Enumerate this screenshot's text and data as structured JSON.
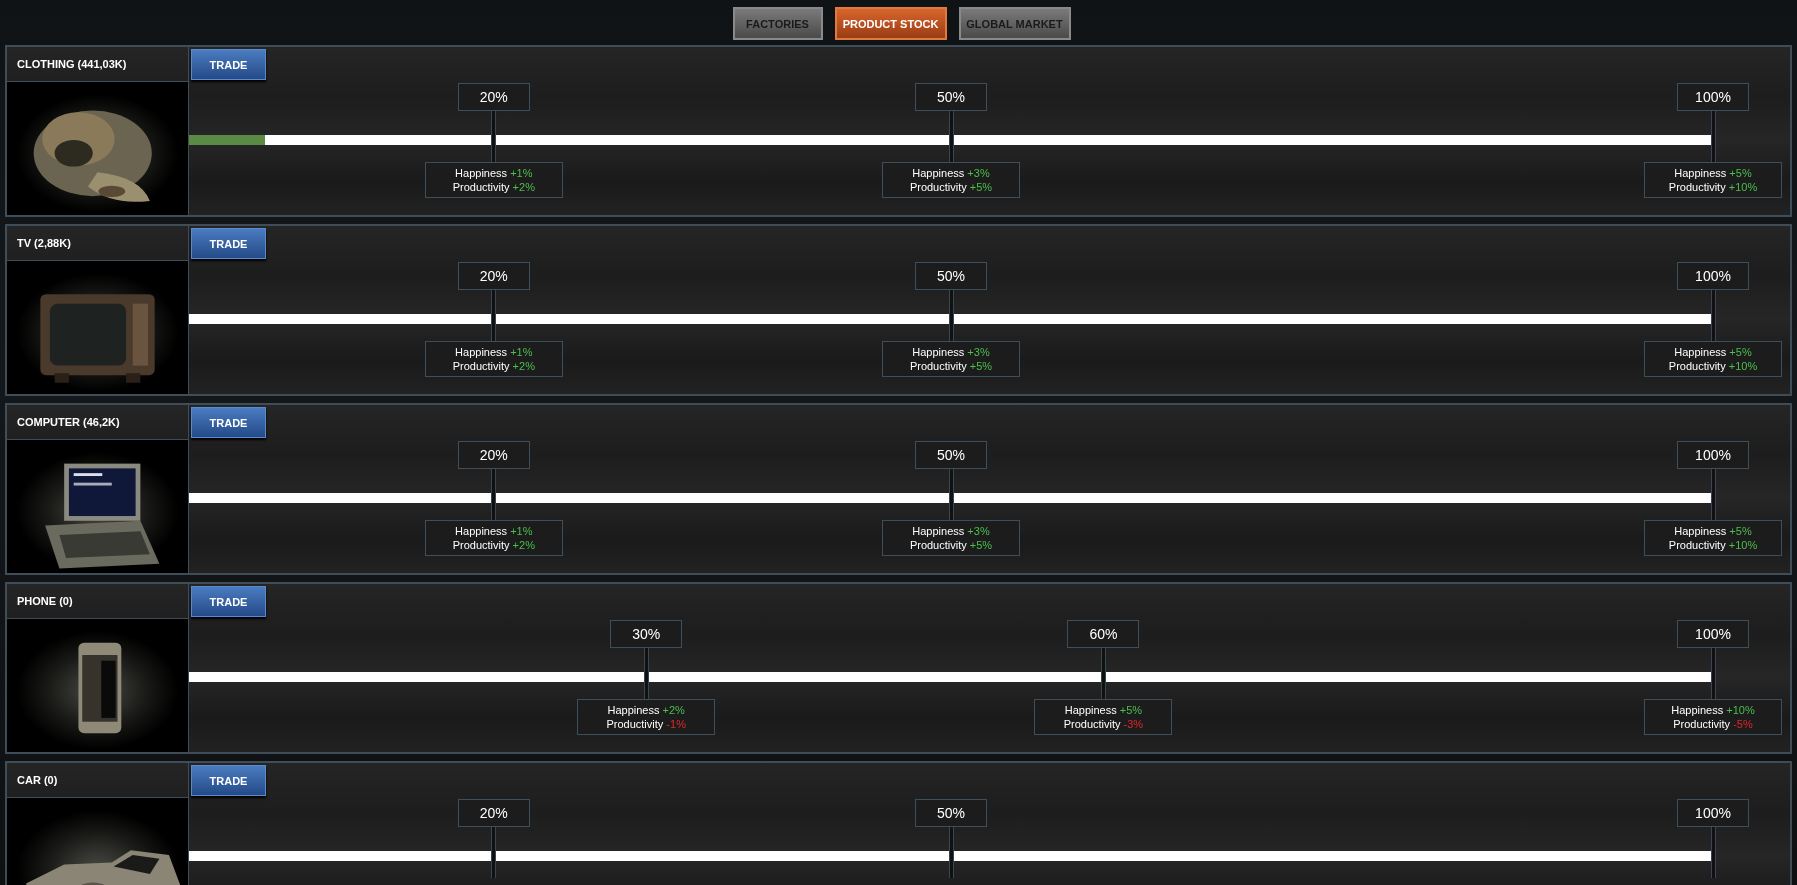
{
  "tabs": [
    {
      "label": "FACTORIES",
      "selected": false
    },
    {
      "label": "PRODUCT STOCK",
      "selected": true
    },
    {
      "label": "GLOBAL MARKET",
      "selected": false
    }
  ],
  "products": [
    {
      "name": "CLOTHING (441,03K)",
      "button": "TRADE",
      "level": 0.05,
      "milestones": [
        {
          "label": "20%",
          "level": 0.2,
          "effects": [
            {
              "label": "Happiness",
              "value": "+1%",
              "kind": "gain"
            },
            {
              "label": "Productivity",
              "value": "+2%",
              "kind": "gain"
            }
          ]
        },
        {
          "label": "50%",
          "level": 0.5,
          "effects": [
            {
              "label": "Happiness",
              "value": "+3%",
              "kind": "gain"
            },
            {
              "label": "Productivity",
              "value": "+5%",
              "kind": "gain"
            }
          ]
        },
        {
          "label": "100%",
          "level": 1,
          "effects": [
            {
              "label": "Happiness",
              "value": "+5%",
              "kind": "gain"
            },
            {
              "label": "Productivity",
              "value": "+10%",
              "kind": "gain"
            }
          ]
        }
      ]
    },
    {
      "name": "TV (2,88K)",
      "button": "TRADE",
      "level": 0,
      "milestones": [
        {
          "label": "20%",
          "level": 0.2,
          "effects": [
            {
              "label": "Happiness",
              "value": "+1%",
              "kind": "gain"
            },
            {
              "label": "Productivity",
              "value": "+2%",
              "kind": "gain"
            }
          ]
        },
        {
          "label": "50%",
          "level": 0.5,
          "effects": [
            {
              "label": "Happiness",
              "value": "+3%",
              "kind": "gain"
            },
            {
              "label": "Productivity",
              "value": "+5%",
              "kind": "gain"
            }
          ]
        },
        {
          "label": "100%",
          "level": 1,
          "effects": [
            {
              "label": "Happiness",
              "value": "+5%",
              "kind": "gain"
            },
            {
              "label": "Productivity",
              "value": "+10%",
              "kind": "gain"
            }
          ]
        }
      ]
    },
    {
      "name": "COMPUTER (46,2K)",
      "button": "TRADE",
      "level": 0,
      "milestones": [
        {
          "label": "20%",
          "level": 0.2,
          "effects": [
            {
              "label": "Happiness",
              "value": "+1%",
              "kind": "gain"
            },
            {
              "label": "Productivity",
              "value": "+2%",
              "kind": "gain"
            }
          ]
        },
        {
          "label": "50%",
          "level": 0.5,
          "effects": [
            {
              "label": "Happiness",
              "value": "+3%",
              "kind": "gain"
            },
            {
              "label": "Productivity",
              "value": "+5%",
              "kind": "gain"
            }
          ]
        },
        {
          "label": "100%",
          "level": 1,
          "effects": [
            {
              "label": "Happiness",
              "value": "+5%",
              "kind": "gain"
            },
            {
              "label": "Productivity",
              "value": "+10%",
              "kind": "gain"
            }
          ]
        }
      ]
    },
    {
      "name": "PHONE (0)",
      "button": "TRADE",
      "level": 0,
      "milestones": [
        {
          "label": "30%",
          "level": 0.3,
          "effects": [
            {
              "label": "Happiness",
              "value": "+2%",
              "kind": "gain"
            },
            {
              "label": "Productivity",
              "value": "-1%",
              "kind": "loss"
            }
          ]
        },
        {
          "label": "60%",
          "level": 0.6,
          "effects": [
            {
              "label": "Happiness",
              "value": "+5%",
              "kind": "gain"
            },
            {
              "label": "Productivity",
              "value": "-3%",
              "kind": "loss"
            }
          ]
        },
        {
          "label": "100%",
          "level": 1,
          "effects": [
            {
              "label": "Happiness",
              "value": "+10%",
              "kind": "gain"
            },
            {
              "label": "Productivity",
              "value": "-5%",
              "kind": "loss"
            }
          ]
        }
      ]
    },
    {
      "name": "CAR (0)",
      "button": "TRADE",
      "level": 0,
      "milestones": [
        {
          "label": "20%",
          "level": 0.2
        },
        {
          "label": "50%",
          "level": 0.5
        },
        {
          "label": "100%",
          "level": 1
        }
      ]
    }
  ]
}
